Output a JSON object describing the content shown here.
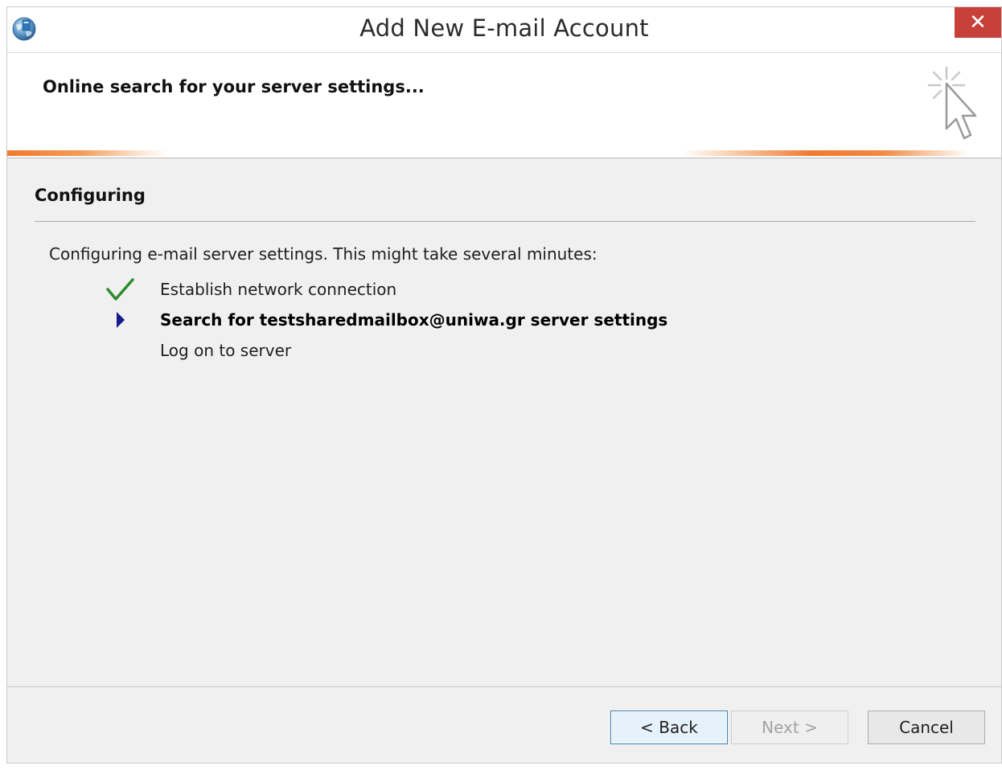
{
  "window": {
    "title": "Add New E-mail Account",
    "close_label": "✕"
  },
  "header": {
    "title": "Online search for your server settings..."
  },
  "section": {
    "title": "Configuring",
    "intro": "Configuring e-mail server settings. This might take several minutes:"
  },
  "steps": [
    {
      "label": "Establish network connection",
      "status": "done",
      "icon": "check-icon"
    },
    {
      "label": "Search for testsharedmailbox@uniwa.gr server settings",
      "status": "in-progress",
      "icon": "arrow-right-icon"
    },
    {
      "label": "Log on to server",
      "status": "pending",
      "icon": ""
    }
  ],
  "buttons": {
    "back": "< Back",
    "next": "Next >",
    "cancel": "Cancel"
  },
  "colors": {
    "close_button": "#c7403a",
    "progress_accent": "#f07a2e",
    "check": "#2e8b2e",
    "arrow": "#1a1a8c"
  }
}
